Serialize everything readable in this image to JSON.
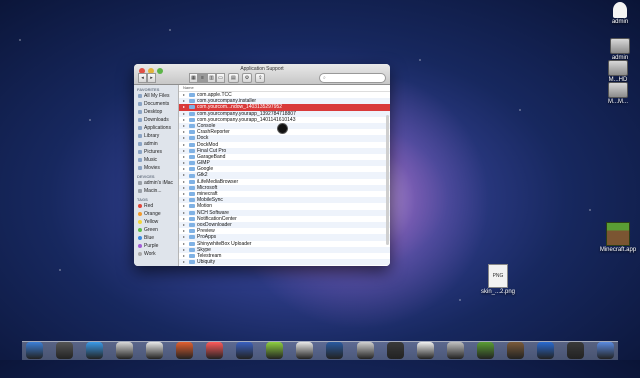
{
  "window": {
    "title": "Application Support",
    "search_placeholder": "",
    "list_header": "Name"
  },
  "sidebar": {
    "favorites_header": "FAVORITES",
    "favorites": [
      "All My Files",
      "Documents",
      "Desktop",
      "Downloads",
      "Applications",
      "Library",
      "admin",
      "Pictures",
      "Music",
      "Movies"
    ],
    "devices_header": "DEVICES",
    "devices": [
      "admin's iMac",
      "Macin..."
    ],
    "tags_header": "TAGS",
    "tags": [
      {
        "label": "Red",
        "color": "#e0463b"
      },
      {
        "label": "Orange",
        "color": "#f29a2e"
      },
      {
        "label": "Yellow",
        "color": "#f2d43a"
      },
      {
        "label": "Green",
        "color": "#5cbb4c"
      },
      {
        "label": "Blue",
        "color": "#3a8ae0"
      },
      {
        "label": "Purple",
        "color": "#a25cd6"
      },
      {
        "label": "Work",
        "color": "#aaaaaa"
      }
    ]
  },
  "files": [
    "com.apple.TCC",
    "com.yourcompany.installer",
    "com.yourcom...ndow_1403135297952",
    "com.yourcompany.yourapp_1392784718807",
    "com.yourcompany.yourapp_1401141610143",
    "Console",
    "CrashReporter",
    "Dock",
    "DockMod",
    "Final Cut Pro",
    "GarageBand",
    "GIMP",
    "Google",
    "Gtk2",
    "iLifeMediaBrowser",
    "Microsoft",
    "minecraft",
    "MobileSync",
    "Motion",
    "NCH Software",
    "NotificationCenter",
    "ooxDownloader",
    "Preview",
    "ProApps",
    "ShinywhiteBox Uploader",
    "Skype",
    "Telestream",
    "Ubiquity"
  ],
  "selected_index": 2,
  "desktop": {
    "user_label": "admin",
    "hd_label": "admin",
    "hd2_label": "M...HD",
    "hd3_label": "M...M...",
    "minecraft_label": "Minecraft.app",
    "png_label": "skin_...2.png",
    "png_tag": "PNG"
  },
  "dock_colors": [
    "#3c7fd6",
    "#555555",
    "#3a9ae8",
    "#d8d8d8",
    "#e8e8e8",
    "#e26030",
    "#ff5a5a",
    "#3a60c0",
    "#8ed040",
    "#e8e8e8",
    "#2a5aa0",
    "#d0d0d0",
    "#3a3a3a",
    "#f0f0f0",
    "#c0c0c0",
    "#5a9d34",
    "#7a5a3a",
    "#2a6ad0",
    "#3a3a3a",
    "#5a8ae0"
  ]
}
